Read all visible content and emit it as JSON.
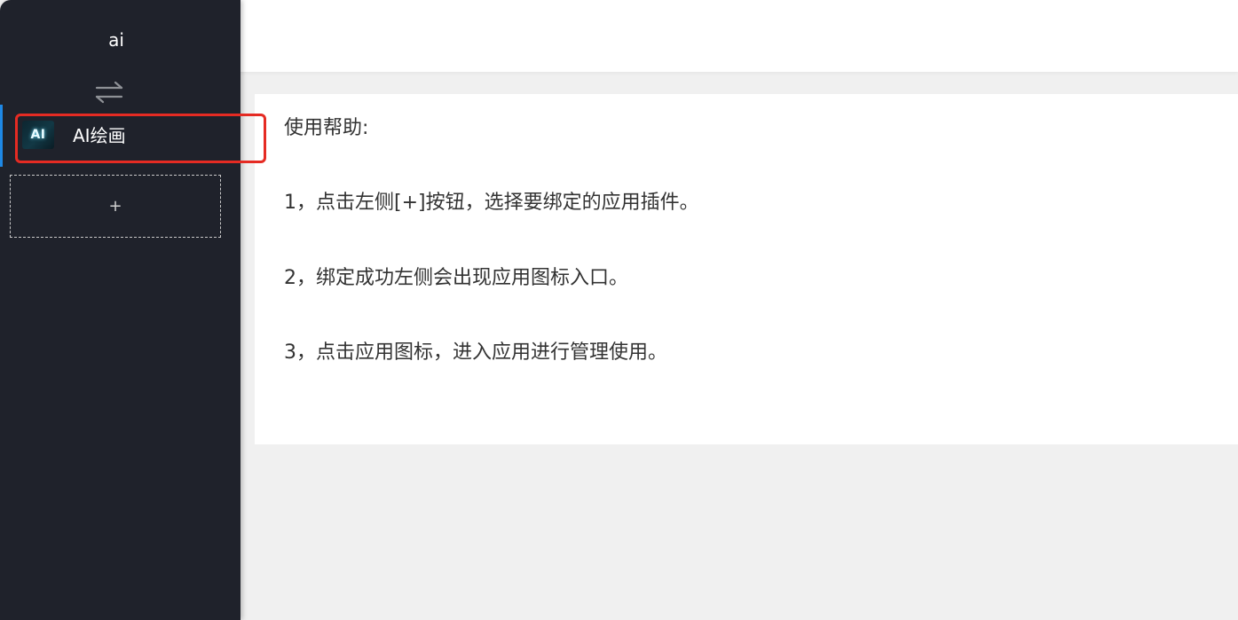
{
  "sidebar": {
    "app_title": "ai",
    "switch_icon": "swap-arrows-icon",
    "items": [
      {
        "label": "AI绘画",
        "icon_text": "AI",
        "icon": "ai-painting-app-icon",
        "active": true
      }
    ],
    "add_label": "+"
  },
  "help": {
    "title": "使用帮助:",
    "steps": [
      "1，点击左侧[+]按钮，选择要绑定的应用插件。",
      "2，绑定成功左侧会出现应用图标入口。",
      "3，点击应用图标，进入应用进行管理使用。"
    ]
  },
  "colors": {
    "sidebar_bg": "#1f222b",
    "active_indicator": "#1e88e5",
    "highlight_border": "#e52b23",
    "content_bg": "#f0f0f0",
    "card_bg": "#ffffff",
    "text": "#333333"
  }
}
